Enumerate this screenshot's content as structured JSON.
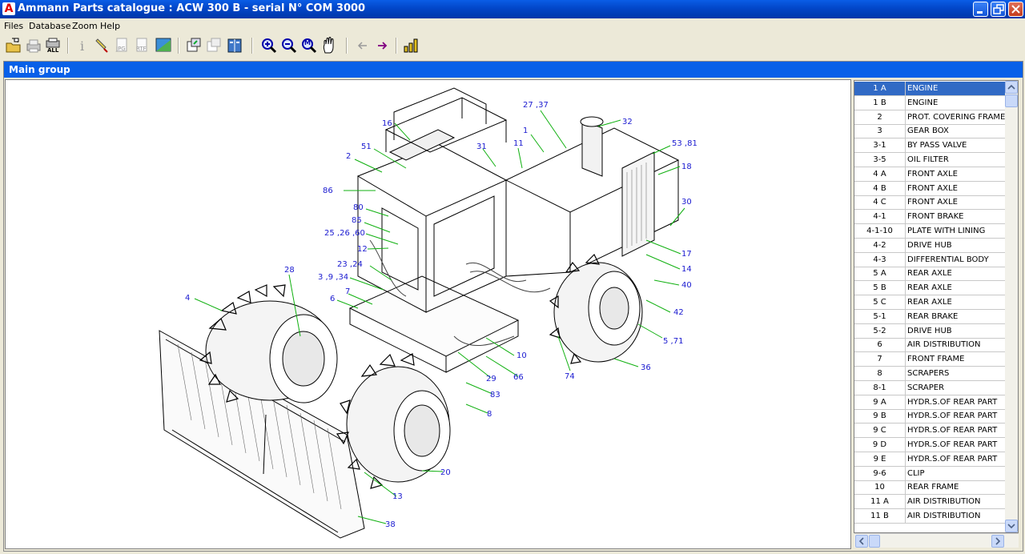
{
  "window": {
    "title": "Ammann Parts catalogue : ACW 300 B - serial N° COM 3000",
    "app_icon_letter": "A"
  },
  "menu": [
    "Files",
    "Database",
    "Zoom",
    "Help"
  ],
  "toolbar": {
    "buttons": [
      "open-folder-icon",
      "print-icon",
      "print-all-icon",
      "info-icon",
      "highlight-icon",
      "jpg-export-icon",
      "rtf-export-icon",
      "image-icon",
      "copy-out-icon",
      "copy-in-icon",
      "book-icon",
      "zoom-in-icon",
      "zoom-out-icon",
      "zoom-fit-icon",
      "pan-hand-icon",
      "back-arrow-icon",
      "forward-arrow-icon",
      "chart-icon"
    ],
    "all_label": "ALL",
    "jpg_label": "JPG",
    "rtf_label": "RTF",
    "fit_label": "M"
  },
  "group_header": "Main group",
  "drawing": {
    "callouts": [
      "16",
      "27 ,37",
      "32",
      "1",
      "2",
      "51",
      "31",
      "11",
      "53 ,81",
      "18",
      "86",
      "30",
      "80",
      "85",
      "25 ,26 ,60",
      "12",
      "17",
      "14",
      "28",
      "23 ,24",
      "3 ,9 ,34",
      "40",
      "7",
      "4",
      "6",
      "42",
      "5 ,71",
      "10",
      "74",
      "36",
      "29",
      "66",
      "83",
      "8",
      "20",
      "13",
      "38"
    ]
  },
  "parts": [
    {
      "code": "1 A",
      "name": "ENGINE",
      "selected": true
    },
    {
      "code": "1 B",
      "name": "ENGINE"
    },
    {
      "code": "2",
      "name": "PROT. COVERING FRAME"
    },
    {
      "code": "3",
      "name": "GEAR BOX"
    },
    {
      "code": "3-1",
      "name": "BY PASS VALVE"
    },
    {
      "code": "3-5",
      "name": "OIL FILTER"
    },
    {
      "code": "4 A",
      "name": "FRONT AXLE"
    },
    {
      "code": "4 B",
      "name": "FRONT AXLE"
    },
    {
      "code": "4 C",
      "name": "FRONT AXLE"
    },
    {
      "code": "4-1",
      "name": "FRONT BRAKE"
    },
    {
      "code": "4-1-10",
      "name": "PLATE WITH LINING"
    },
    {
      "code": "4-2",
      "name": "DRIVE HUB"
    },
    {
      "code": "4-3",
      "name": "DIFFERENTIAL BODY"
    },
    {
      "code": "5 A",
      "name": "REAR AXLE"
    },
    {
      "code": "5 B",
      "name": "REAR AXLE"
    },
    {
      "code": "5 C",
      "name": "REAR AXLE"
    },
    {
      "code": "5-1",
      "name": "REAR BRAKE"
    },
    {
      "code": "5-2",
      "name": "DRIVE HUB"
    },
    {
      "code": "6",
      "name": "AIR DISTRIBUTION"
    },
    {
      "code": "7",
      "name": "FRONT FRAME"
    },
    {
      "code": "8",
      "name": "SCRAPERS"
    },
    {
      "code": "8-1",
      "name": "SCRAPER"
    },
    {
      "code": "9 A",
      "name": "HYDR.S.OF REAR PART"
    },
    {
      "code": "9 B",
      "name": "HYDR.S.OF REAR PART"
    },
    {
      "code": "9 C",
      "name": "HYDR.S.OF REAR PART"
    },
    {
      "code": "9 D",
      "name": "HYDR.S.OF REAR PART"
    },
    {
      "code": "9 E",
      "name": "HYDR.S.OF REAR PART"
    },
    {
      "code": "9-6",
      "name": "CLIP"
    },
    {
      "code": "10",
      "name": "REAR FRAME"
    },
    {
      "code": "11 A",
      "name": "AIR DISTRIBUTION"
    },
    {
      "code": "11 B",
      "name": "AIR DISTRIBUTION"
    }
  ],
  "colors": {
    "title_bar": "#0246c8",
    "group_header": "#0860e8",
    "selection": "#316ac5",
    "callout_text": "#1a1ad0",
    "callout_leader": "#10b010"
  }
}
